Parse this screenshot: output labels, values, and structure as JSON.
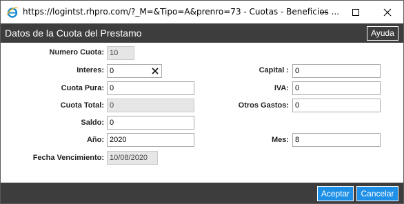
{
  "window": {
    "title": "https://logintst.rhpro.com/?_M=&Tipo=A&prenro=73 - Cuotas - Beneficios ..."
  },
  "header": {
    "title": "Datos de la Cuota del Prestamo",
    "help_label": "Ayuda"
  },
  "form": {
    "numero_cuota": {
      "label": "Numero Cuota:",
      "value": "10"
    },
    "interes": {
      "label": "Interes:",
      "value": "0"
    },
    "capital": {
      "label": "Capital :",
      "value": "0"
    },
    "cuota_pura": {
      "label": "Cuota Pura:",
      "value": "0"
    },
    "iva": {
      "label": "IVA:",
      "value": "0"
    },
    "cuota_total": {
      "label": "Cuota Total:",
      "value": "0"
    },
    "otros_gastos": {
      "label": "Otros Gastos:",
      "value": "0"
    },
    "saldo": {
      "label": "Saldo:",
      "value": "0"
    },
    "anio": {
      "label": "Año:",
      "value": "2020"
    },
    "mes": {
      "label": "Mes:",
      "value": "8"
    },
    "fecha_vencimiento": {
      "label": "Fecha Vencimiento:",
      "value": "10/08/2020"
    }
  },
  "footer": {
    "accept_label": "Aceptar",
    "cancel_label": "Cancelar"
  },
  "colors": {
    "header_bg": "#3d3d3d",
    "button_blue": "#1e90e8"
  }
}
